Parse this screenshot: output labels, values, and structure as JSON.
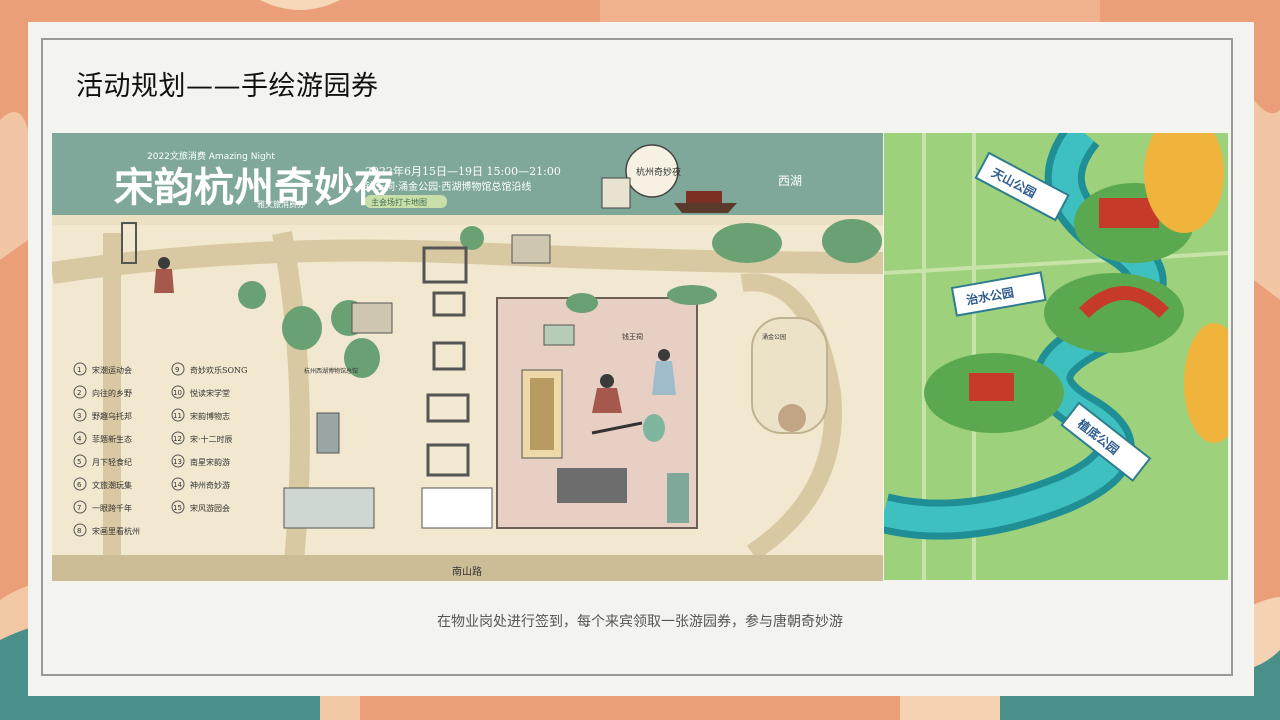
{
  "slide": {
    "title": "活动规划——手绘游园券",
    "caption": "在物业岗处进行签到，每个来宾领取一张游园券，参与唐朝奇妙游"
  },
  "map": {
    "banner_title": "宋韵杭州奇妙夜",
    "banner_subtitle_small": "2022文旅消费 Amazing Night",
    "date_line": "2022年6月15日—19日 15:00—21:00",
    "route_line": "钱王祠·涌金公园·西湖博物馆总馆沿线",
    "tag_line": "主会场打卡地图",
    "voucher_label": "雅文旅消费券",
    "west_lake_label": "西湖",
    "road_label": "南山路",
    "stamp_text": "杭州奇妙夜",
    "qianwang_label": "钱王祠",
    "yongjin_label": "涌金公园",
    "museum_label": "杭州西湖博物馆总馆",
    "legend": [
      {
        "num": "1",
        "text": "宋潮运动会"
      },
      {
        "num": "2",
        "text": "向往的乡野"
      },
      {
        "num": "3",
        "text": "野趣乌托邦"
      },
      {
        "num": "4",
        "text": "菲题新生态"
      },
      {
        "num": "5",
        "text": "月下轻食纪"
      },
      {
        "num": "6",
        "text": "文旅潮玩集"
      },
      {
        "num": "7",
        "text": "一眼跨千年"
      },
      {
        "num": "8",
        "text": "宋画里看杭州"
      },
      {
        "num": "9",
        "text": "奇妙欢乐SONG"
      },
      {
        "num": "10",
        "text": "悦读宋学堂"
      },
      {
        "num": "11",
        "text": "宋韵博物志"
      },
      {
        "num": "12",
        "text": "宋·十二时辰"
      },
      {
        "num": "13",
        "text": "南星宋韵游"
      },
      {
        "num": "14",
        "text": "神州奇妙游"
      },
      {
        "num": "15",
        "text": "宋风游园会"
      }
    ],
    "side_labels": [
      "天山公园",
      "治水公园",
      "植底公园"
    ]
  },
  "colors": {
    "banner": "#7fa89a",
    "map_ground": "#f1e8cf",
    "path": "#d8c9a2",
    "frame_bg": "#f3f4ef",
    "river": "#2fa6a6",
    "grass": "#8ec46a"
  }
}
